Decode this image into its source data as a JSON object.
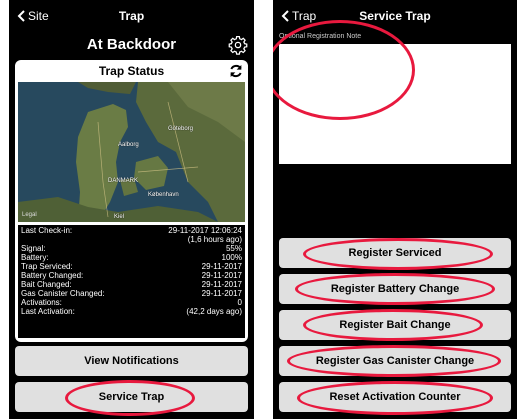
{
  "left": {
    "nav": {
      "back_label": "Site",
      "title": "Trap"
    },
    "page_title": "At Backdoor",
    "status_card": {
      "title": "Trap Status",
      "map_labels": {
        "goteborg": "Göteborg",
        "aalborg": "Aalborg",
        "danmark": "DANMARK",
        "kobenhavn": "København",
        "kiel": "Kiel",
        "legal": "Legal"
      },
      "last_checkin": {
        "label": "Last Check-in:",
        "value": "29-11-2017 12:06:24",
        "ago": "(1,6 hours ago)"
      },
      "rows": [
        {
          "label": "Signal:",
          "value": "55%"
        },
        {
          "label": "Battery:",
          "value": "100%"
        },
        {
          "label": "Trap Serviced:",
          "value": "29-11-2017"
        },
        {
          "label": "Battery Changed:",
          "value": "29-11-2017"
        },
        {
          "label": "Bait Changed:",
          "value": "29-11-2017"
        },
        {
          "label": "Gas Canister Changed:",
          "value": "29-11-2017"
        },
        {
          "label": "Activations:",
          "value": "0"
        },
        {
          "label": "Last Activation:",
          "value": "(42,2 days ago)"
        }
      ]
    },
    "buttons": {
      "view_notifications": "View Notifications",
      "service_trap": "Service Trap"
    }
  },
  "right": {
    "nav": {
      "back_label": "Trap",
      "title": "Service Trap"
    },
    "note_label": "Optional Registration Note",
    "note_value": "",
    "buttons": {
      "register_serviced": "Register Serviced",
      "register_battery": "Register Battery Change",
      "register_bait": "Register Bait Change",
      "register_gas": "Register Gas Canister Change",
      "reset_counter": "Reset Activation Counter"
    }
  },
  "colors": {
    "background": "#000000",
    "button": "#e0e0e0",
    "annotation": "#e8193e"
  }
}
